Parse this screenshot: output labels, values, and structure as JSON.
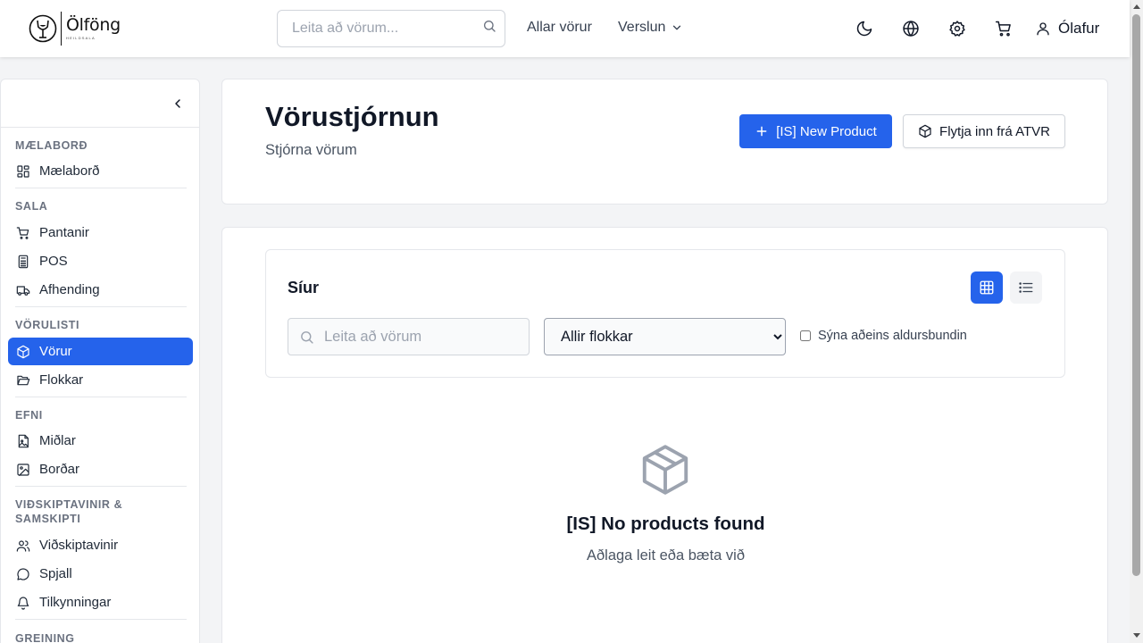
{
  "brand": {
    "name": "Ölföng",
    "tagline": "HEILDSALA"
  },
  "topnav": {
    "search_placeholder": "Leita að vörum...",
    "all_products": "Allar vörur",
    "store": "Verslun",
    "user_name": "Ólafur"
  },
  "sidebar": {
    "sections": {
      "dashboard": "MÆLABORÐ",
      "sales": "SALA",
      "catalog": "VÖRULISTI",
      "content": "EFNI",
      "customers": "VIÐSKIPTAVINIR & SAMSKIPTI",
      "analytics": "GREINING"
    },
    "items": {
      "dashboard": "Mælaborð",
      "orders": "Pantanir",
      "pos": "POS",
      "delivery": "Afhending",
      "products": "Vörur",
      "categories": "Flokkar",
      "media": "Miðlar",
      "banners": "Borðar",
      "customers": "Viðskiptavinir",
      "chat": "Spjall",
      "notifications": "Tilkynningar"
    },
    "active": "products"
  },
  "header": {
    "title": "Vörustjórnun",
    "subtitle": "Stjórna vörum",
    "new_product_label": "[IS] New Product",
    "import_label": "Flytja inn frá ATVR"
  },
  "filters": {
    "title": "Síur",
    "search_placeholder": "Leita að vörum",
    "category_selected": "Allir flokkar",
    "age_restricted_label": "Sýna aðeins aldursbundin",
    "age_restricted_checked": false,
    "view_mode": "grid"
  },
  "empty_state": {
    "title": "[IS] No products found",
    "subtitle": "Aðlaga leit eða bæta við",
    "icon": "package-icon"
  },
  "colors": {
    "accent": "#2563eb",
    "text": "#111827",
    "muted": "#6b7280",
    "border": "#e5e7eb",
    "background": "#f3f4f6"
  }
}
